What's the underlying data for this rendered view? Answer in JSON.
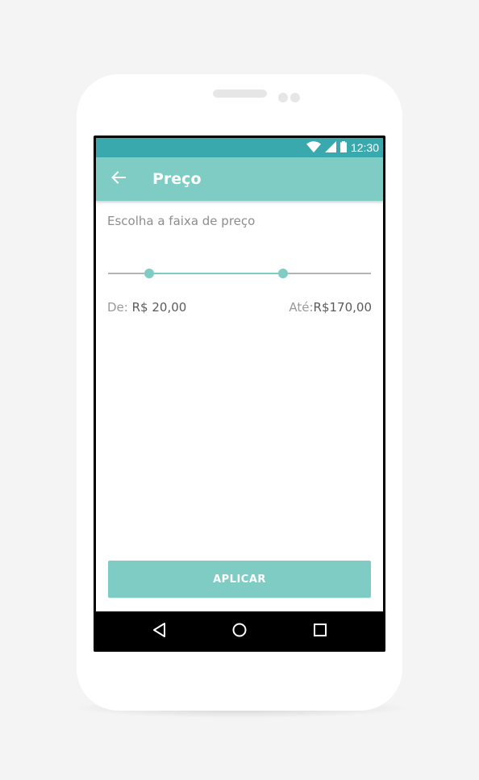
{
  "status_bar": {
    "time": "12:30",
    "icons": [
      "wifi-icon",
      "signal-icon",
      "battery-icon"
    ]
  },
  "toolbar": {
    "back_icon": "arrow-left-icon",
    "title": "Preço"
  },
  "filter": {
    "subtitle": "Escolha a faixa de preço",
    "slider": {
      "min_fraction": 0.157,
      "max_fraction": 0.666
    },
    "from_label": "De:",
    "from_value": "R$ 20,00",
    "to_label": "Até:",
    "to_value": "R$170,00"
  },
  "apply_button": {
    "label": "APLICAR"
  },
  "nav_bar": {
    "icons": [
      "nav-back-icon",
      "nav-home-icon",
      "nav-recents-icon"
    ]
  },
  "colors": {
    "accent": "#7fccc5",
    "status_bar": "#3aa9ae",
    "track": "#b4b4b4",
    "background": "#f4f4f4"
  }
}
